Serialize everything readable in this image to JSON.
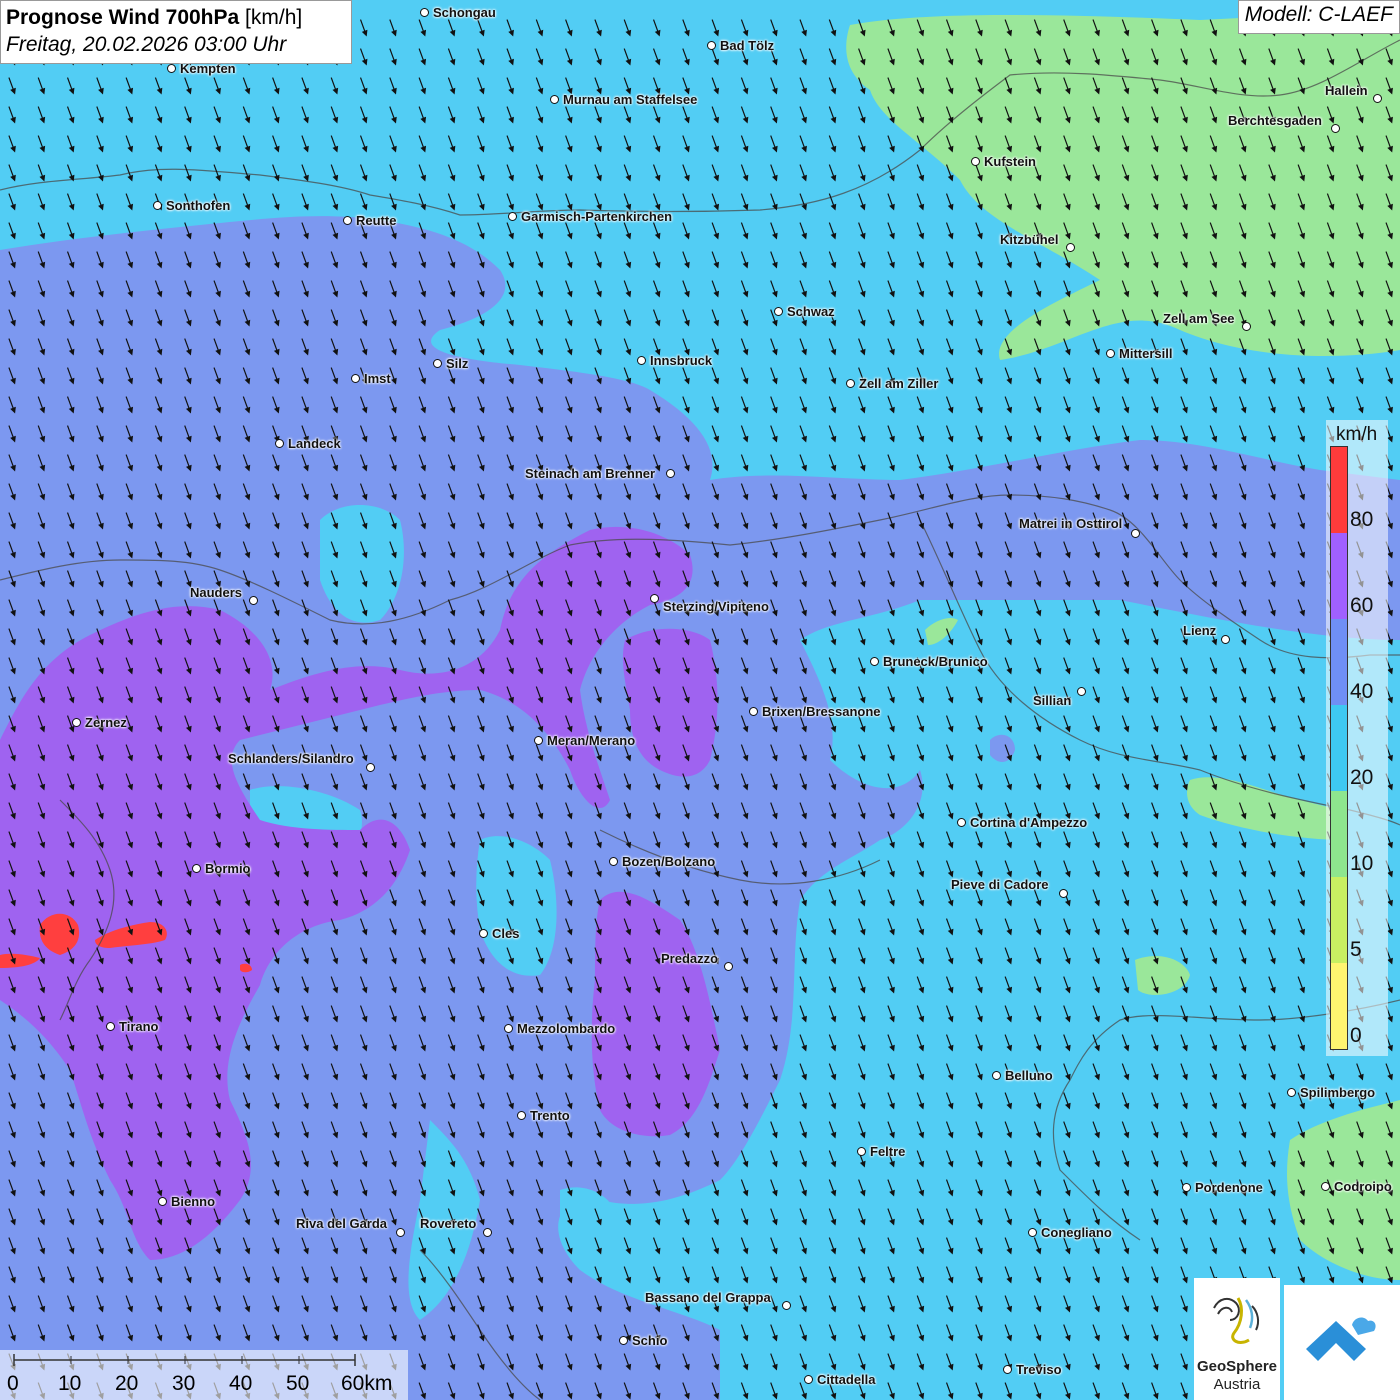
{
  "title": {
    "main_bold": "Prognose Wind 700hPa",
    "main_unit": "[km/h]",
    "datetime": "Freitag, 20.02.2026 03:00 Uhr"
  },
  "model_label": "Modell: C-LAEF",
  "legend": {
    "unit": "km/h",
    "ticks": [
      "80",
      "60",
      "40",
      "20",
      "10",
      "5",
      "0"
    ],
    "colors": [
      "#ff3b3b",
      "#a060ff",
      "#6f8ff5",
      "#3ec8f2",
      "#8ee68e",
      "#c8f062",
      "#fff570"
    ]
  },
  "colors": {
    "wind_20_40": "#52cdf4",
    "wind_40_60": "#7c98f0",
    "wind_60_80": "#9f63f0",
    "wind_80_plus": "#ff3f3f",
    "wind_10_20": "#9ae79a"
  },
  "scale_bar": {
    "labels": [
      "0",
      "10",
      "20",
      "30",
      "40",
      "50",
      "60km"
    ]
  },
  "logos": {
    "geosphere_line1": "GeoSphere",
    "geosphere_line2": "Austria"
  },
  "cities": [
    "Schongau",
    "Bad Tölz",
    "Kempten",
    "Murnau am Staffelsee",
    "Hallein",
    "Berchtesgaden",
    "Kufstein",
    "Sonthofen",
    "Reutte",
    "Garmisch-Partenkirchen",
    "Kitzbühel",
    "Schwaz",
    "Zell am See",
    "Mittersill",
    "Innsbruck",
    "Silz",
    "Imst",
    "Zell am Ziller",
    "Landeck",
    "Steinach am Brenner",
    "Matrei in Osttirol",
    "Nauders",
    "Sterzing/Vipiteno",
    "Lienz",
    "Bruneck/Brunico",
    "Sillian",
    "Zernez",
    "Brixen/Bressanone",
    "Meran/Merano",
    "Schlanders/Silandro",
    "Cortina d'Ampezzo",
    "Bozen/Bolzano",
    "Bormio",
    "Pieve di Cadore",
    "Cles",
    "Predazzo",
    "Tirano",
    "Mezzolombardo",
    "Belluno",
    "Spilimbergo",
    "Trento",
    "Feltre",
    "Pordenone",
    "Codroipo",
    "Bienno",
    "Riva del Garda",
    "Rovereto",
    "Conegliano",
    "Bassano del Grappa",
    "Schio",
    "Treviso",
    "Cittadella"
  ]
}
